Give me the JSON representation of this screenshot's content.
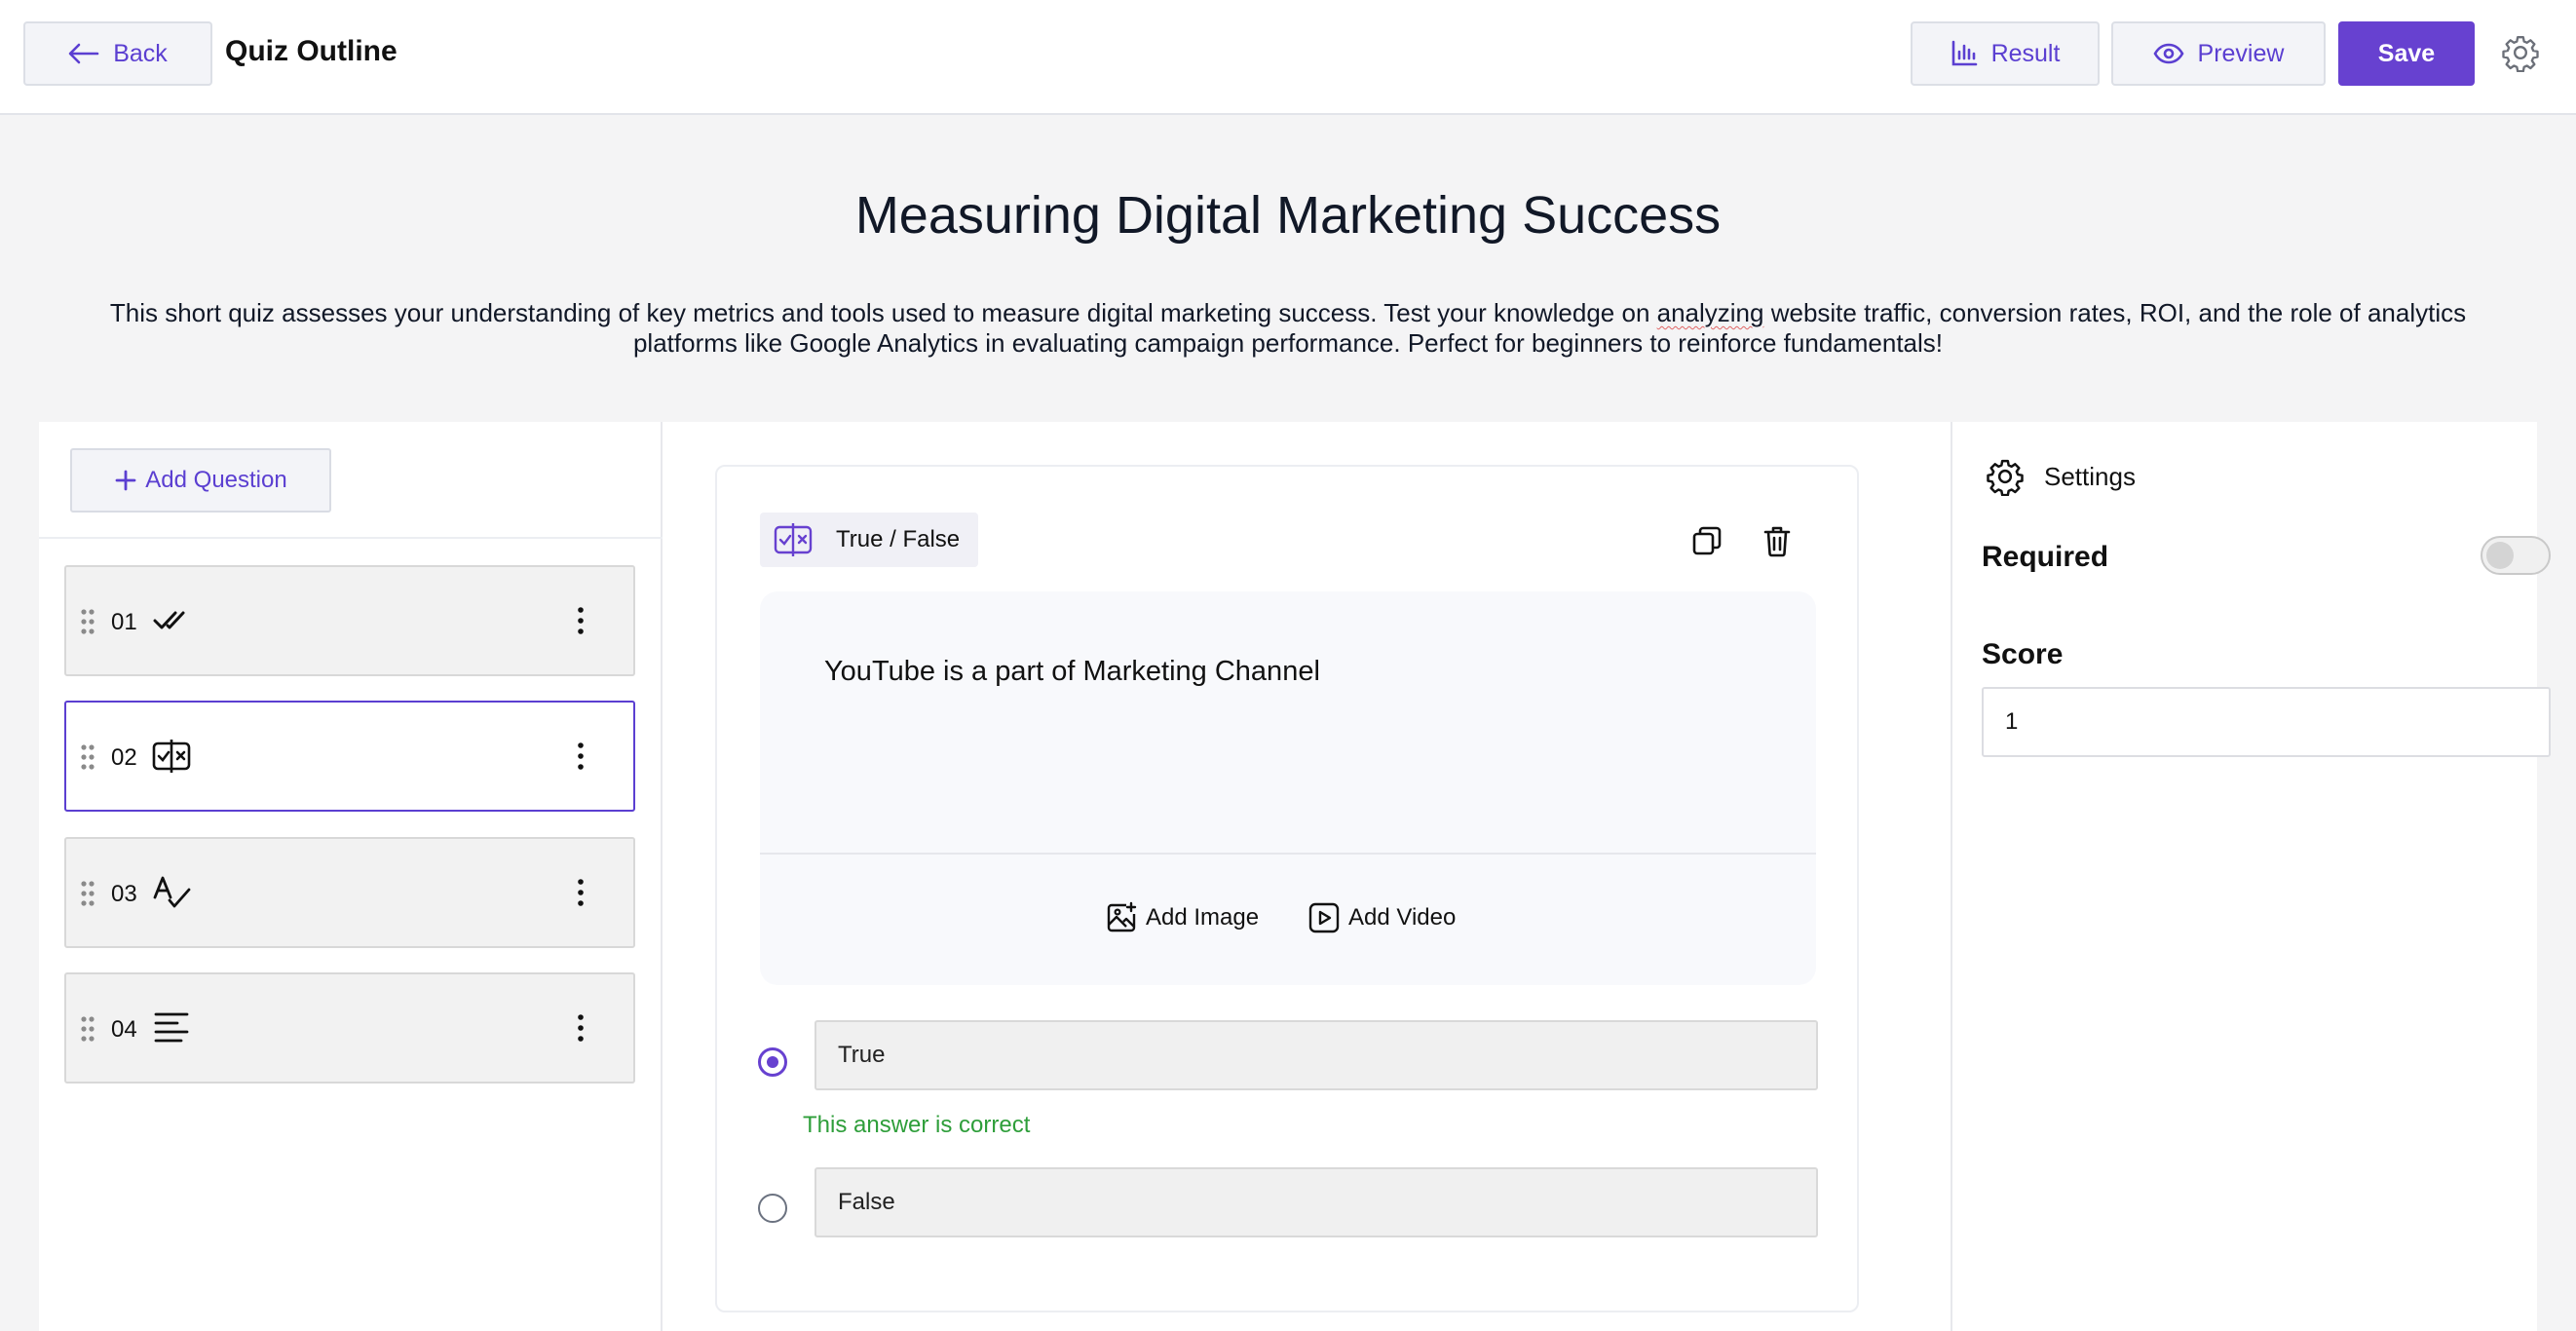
{
  "header": {
    "back_label": "Back",
    "title": "Quiz Outline",
    "result_label": "Result",
    "preview_label": "Preview",
    "save_label": "Save"
  },
  "quiz": {
    "title": "Measuring Digital Marketing Success",
    "description_part1": "This short quiz assesses your understanding of key metrics and tools used to measure digital marketing success. Test your knowledge on ",
    "description_misspelled": "analyzing",
    "description_part2": " website traffic, conversion rates, ROI, and the role of analytics platforms like Google Analytics in evaluating campaign performance. Perfect for beginners to reinforce fundamentals!"
  },
  "sidebar": {
    "add_question_label": "Add Question",
    "questions": [
      {
        "number": "01",
        "type_icon": "double-check-icon",
        "active": false
      },
      {
        "number": "02",
        "type_icon": "true-false-icon",
        "active": true
      },
      {
        "number": "03",
        "type_icon": "spell-check-icon",
        "active": false
      },
      {
        "number": "04",
        "type_icon": "paragraph-lines-icon",
        "active": false
      }
    ]
  },
  "editor": {
    "type_label": "True / False",
    "question_text": "YouTube is a part of Marketing Channel",
    "add_image_label": "Add Image",
    "add_video_label": "Add Video",
    "answers": [
      {
        "text": "True",
        "selected": true
      },
      {
        "text": "False",
        "selected": false
      }
    ],
    "correct_note": "This answer is correct"
  },
  "settings": {
    "title": "Settings",
    "required_label": "Required",
    "required_on": false,
    "score_label": "Score",
    "score_value": "1"
  },
  "colors": {
    "accent": "#6741d0",
    "correct": "#2e9e3a",
    "background": "#f4f4f5"
  }
}
